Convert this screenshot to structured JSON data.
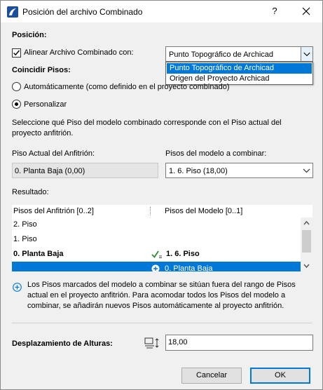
{
  "window": {
    "title": "Posición del archivo Combinado",
    "help_label": "?"
  },
  "position": {
    "heading": "Posición:",
    "align_label": "Alinear Archivo Combinado con:",
    "align_checked": true,
    "align_selected": "Punto Topográfico de Archicad",
    "align_options": [
      "Punto Topográfico de Archicad",
      "Origen del Proyecto Archicad"
    ]
  },
  "floors": {
    "heading": "Coincidir Pisos:",
    "auto_label": "Automáticamente (como definido en el proyecto combinado)",
    "custom_label": "Personalizar",
    "selected_mode": "custom",
    "description": "Seleccione qué Piso del modelo combinado corresponde con el Piso actual del proyecto anfitrión.",
    "host_label": "Piso Actual del Anfitrión:",
    "host_value": "0. Planta Baja (0,00)",
    "model_label": "Pisos del modelo a combinar:",
    "model_value": "1. 6. Piso (18,00)"
  },
  "result": {
    "heading": "Resultado:",
    "columns": [
      "Pisos del Anfitrión [0..2]",
      "Pisos del Modelo [0..1]"
    ],
    "rows": [
      {
        "host": "2. Piso",
        "model": ""
      },
      {
        "host": "1. Piso",
        "model": ""
      },
      {
        "host": "0. Planta Baja",
        "model": "1. 6. Piso"
      },
      {
        "host": "",
        "model": "0. Planta Baja"
      }
    ]
  },
  "info": {
    "text": "Los Pisos marcados del modelo a combinar se sitúan fuera del rango de Pisos actual en el proyecto anfitrión. Para acomodar todos los Pisos del modelo a combinar, se añadirán nuevos Pisos automáticamente al proyecto anfitrión."
  },
  "offset": {
    "label": "Desplazamiento de Alturas:",
    "value": "18,00"
  },
  "buttons": {
    "cancel": "Cancelar",
    "ok": "OK"
  },
  "colors": {
    "accent": "#0078d7",
    "check_green": "#2e8b2e",
    "dialog_bg": "#f0f0f0"
  },
  "icons": {
    "app": "archicad-app-icon",
    "help": "help-icon",
    "close": "close-icon",
    "info": "info-plus-icon",
    "offset": "elevation-offset-icon"
  }
}
